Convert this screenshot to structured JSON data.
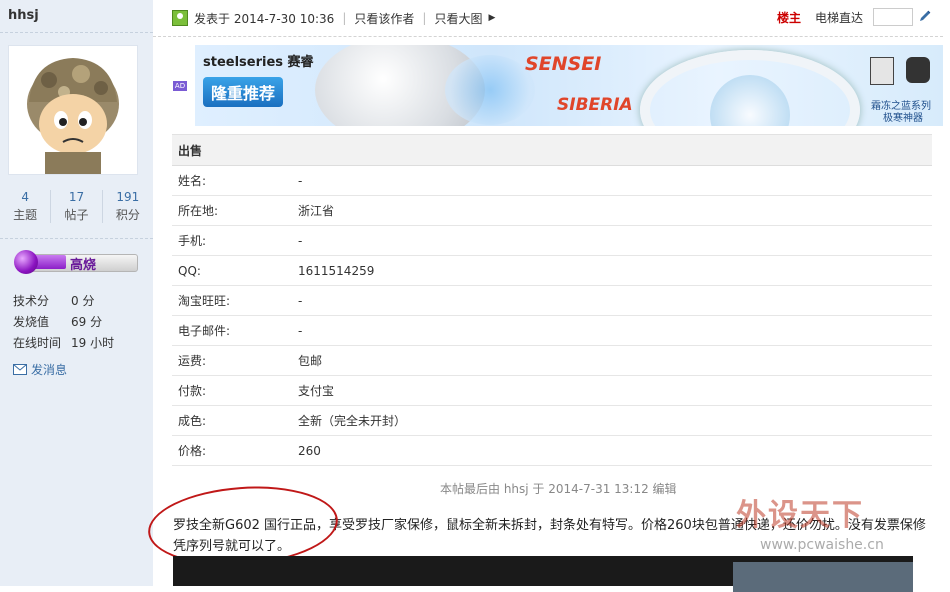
{
  "sidebar": {
    "username": "hhsj",
    "stats": [
      {
        "num": "4",
        "label": "主题"
      },
      {
        "num": "17",
        "label": "帖子"
      },
      {
        "num": "191",
        "label": "积分"
      }
    ],
    "rank": "高烧",
    "info": [
      {
        "label": "技术分",
        "value": "0 分"
      },
      {
        "label": "发烧值",
        "value": "69 分"
      },
      {
        "label": "在线时间",
        "value": "19 小时"
      }
    ],
    "message_label": "发消息"
  },
  "topbar": {
    "posted": "发表于 2014-7-30 10:36",
    "only_author": "只看该作者",
    "big_image": "只看大图",
    "floor": "楼主",
    "elevator": "电梯直达"
  },
  "banner": {
    "badge": "AD",
    "brand": "steelseries 赛睿",
    "slogan": "隆重推荐",
    "sensei": "SENSEI",
    "siberia": "SIBERIA",
    "series_line1": "霜冻之蓝系列",
    "series_line2": "极寒神器"
  },
  "table": {
    "header": "出售",
    "rows": [
      {
        "k": "姓名:",
        "v": "-"
      },
      {
        "k": "所在地:",
        "v": "浙江省"
      },
      {
        "k": "手机:",
        "v": "-"
      },
      {
        "k": "QQ:",
        "v": "1611514259"
      },
      {
        "k": "淘宝旺旺:",
        "v": "-"
      },
      {
        "k": "电子邮件:",
        "v": "-"
      },
      {
        "k": "运费:",
        "v": "包邮"
      },
      {
        "k": "付款:",
        "v": "支付宝"
      },
      {
        "k": "成色:",
        "v": "全新（完全未开封）"
      },
      {
        "k": "价格:",
        "v": "260"
      }
    ]
  },
  "edited_note": "本帖最后由 hhsj 于 2014-7-31 13:12 编辑",
  "body_text": "罗技全新G602 国行正品，享受罗技厂家保修，鼠标全新未拆封，封条处有特写。价格260块包普通快递，还价勿扰。没有发票保修凭序列号就可以了。",
  "watermark": {
    "title": "外设天下",
    "url": "www.pcwaishe.cn"
  },
  "colors": {
    "sidebar_bg": "#e8eef6",
    "floor": "#cc0000",
    "link": "#3a6ea5",
    "annotation": "#c01818"
  }
}
